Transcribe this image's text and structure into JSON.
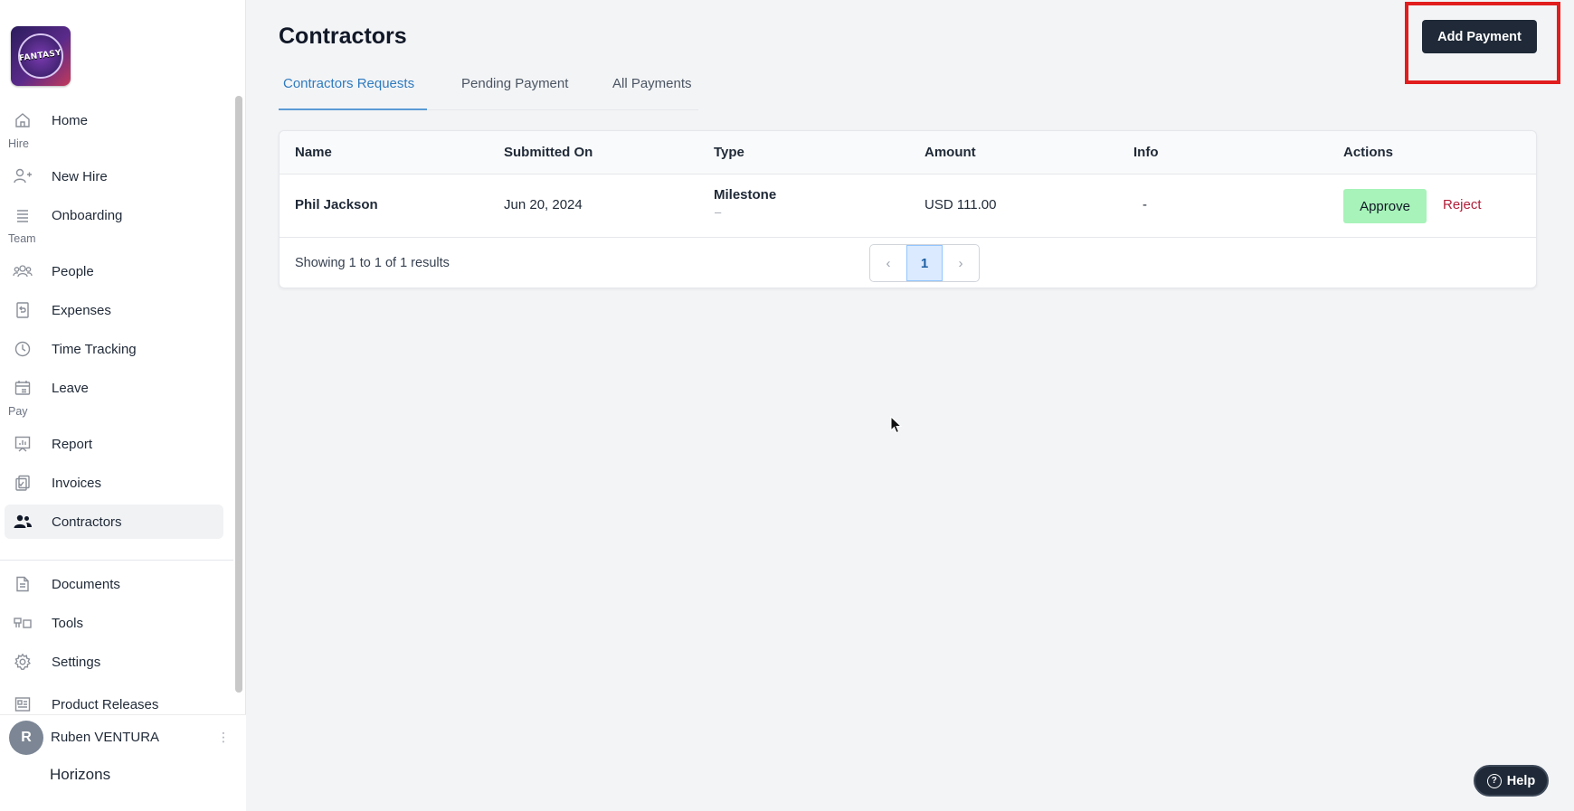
{
  "sidebar": {
    "logo_text": "FANTASY",
    "sections": {
      "hire": "Hire",
      "team": "Team",
      "pay": "Pay"
    },
    "items": {
      "home": "Home",
      "new_hire": "New Hire",
      "onboarding": "Onboarding",
      "people": "People",
      "expenses": "Expenses",
      "time_tracking": "Time Tracking",
      "leave": "Leave",
      "report": "Report",
      "invoices": "Invoices",
      "contractors": "Contractors",
      "documents": "Documents",
      "tools": "Tools",
      "settings": "Settings",
      "product_releases": "Product Releases"
    },
    "user": {
      "initial": "R",
      "name": "Ruben VENTURA",
      "company": "Horizons"
    }
  },
  "main": {
    "title": "Contractors",
    "add_payment_label": "Add Payment",
    "tabs": [
      "Contractors Requests",
      "Pending Payment",
      "All Payments"
    ],
    "table": {
      "headers": [
        "Name",
        "Submitted On",
        "Type",
        "Amount",
        "Info",
        "Actions"
      ],
      "rows": [
        {
          "name": "Phil Jackson",
          "submitted_on": "Jun 20, 2024",
          "type": "Milestone",
          "type_sub": "–",
          "amount": "USD 111.00",
          "info": "-",
          "approve_label": "Approve",
          "reject_label": "Reject"
        }
      ],
      "results_text": "Showing 1 to 1 of 1 results",
      "pagination": {
        "prev": "‹",
        "current": "1",
        "next": "›"
      }
    }
  },
  "help_label": "Help",
  "colors": {
    "accent_tab": "#2f7bbf",
    "approve_bg": "#a7f3b9",
    "reject": "#b0203a",
    "highlight_box": "#e11d1d",
    "primary_button": "#1f2937"
  }
}
